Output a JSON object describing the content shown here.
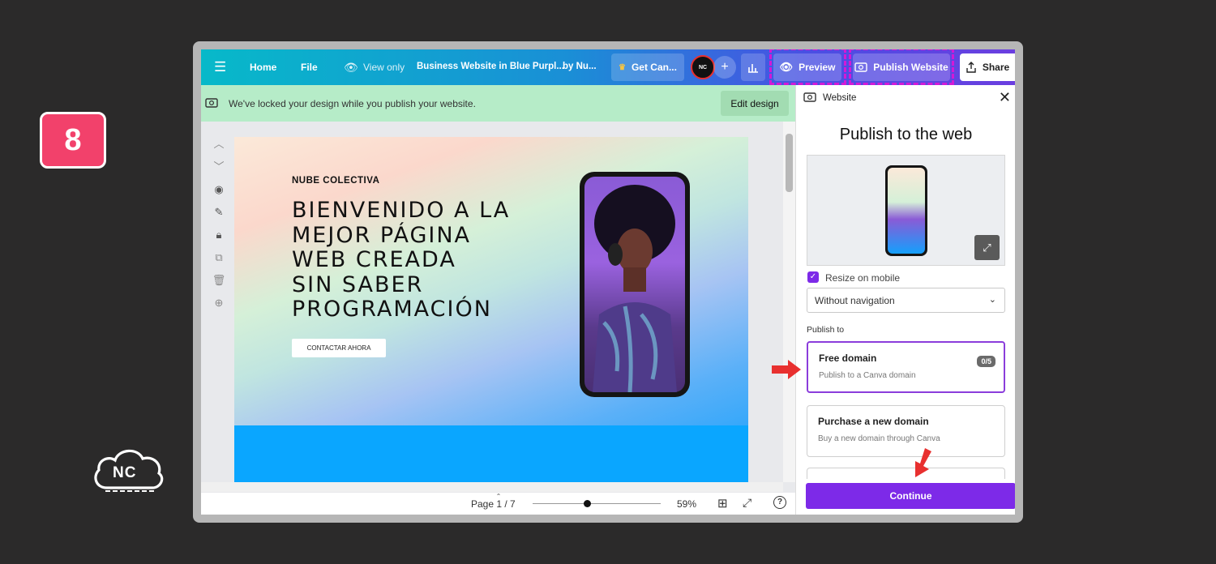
{
  "step_badge": "8",
  "logo_text": "NC",
  "topbar": {
    "home": "Home",
    "file": "File",
    "view_only": "View only",
    "doc_title": "Business Website in Blue Purpl...",
    "by_author": "by Nu...",
    "get_canva": "Get Can...",
    "avatar": "NC",
    "plus": "+",
    "preview": "Preview",
    "publish": "Publish Website",
    "share": "Share"
  },
  "lock_banner": {
    "message": "We've locked your design while you publish your website.",
    "edit_button": "Edit design"
  },
  "design": {
    "brand": "NUBE COLECTIVA",
    "headline": [
      "BIENVENIDO A LA",
      "MEJOR PÁGINA",
      "WEB CREADA",
      "SIN SABER",
      "PROGRAMACIÓN"
    ],
    "cta": "CONTACTAR AHORA"
  },
  "bottom_bar": {
    "page_indicator": "Page 1 / 7",
    "zoom": "59%",
    "zoom_fraction": 0.59,
    "help": "?"
  },
  "panel": {
    "header": "Website",
    "title": "Publish to the web",
    "resize_on_mobile": "Resize on mobile",
    "resize_checked": true,
    "navigation_select": "Without navigation",
    "publish_to_label": "Publish to",
    "options": [
      {
        "title": "Free domain",
        "desc": "Publish to a Canva domain",
        "count": "0/5"
      },
      {
        "title": "Purchase a new domain",
        "desc": "Buy a new domain through Canva"
      }
    ],
    "continue": "Continue"
  },
  "colors": {
    "accent_purple": "#7d2ae8",
    "badge_pink": "#f2416b",
    "annotation_red": "#e8302f",
    "highlight_dash": "#d21ad6",
    "lock_banner": "#b6ecc8"
  }
}
